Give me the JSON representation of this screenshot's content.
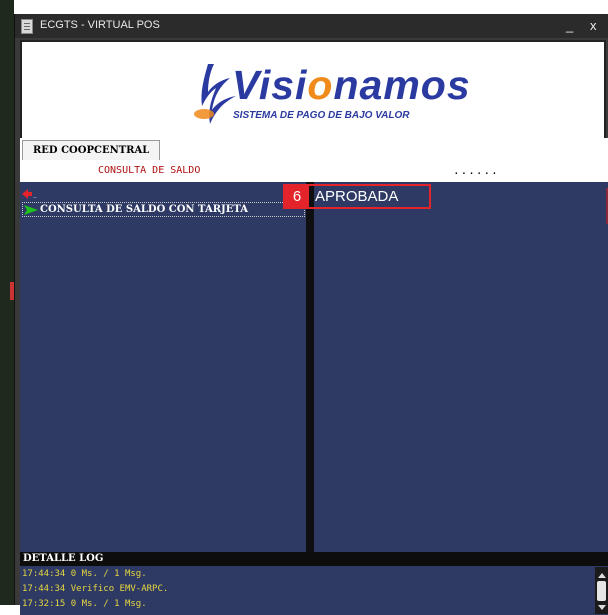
{
  "window": {
    "title": "ECGTS - VIRTUAL POS",
    "minimize_label": "_",
    "close_label": "x"
  },
  "logo": {
    "brand_prefix": "Visi",
    "brand_o": "o",
    "brand_suffix": "namos",
    "tagline": "SISTEMA DE PAGO DE BAJO VALOR"
  },
  "tabs": [
    {
      "label": "RED COOPCENTRAL"
    }
  ],
  "operation": {
    "title": "CONSULTA DE SALDO",
    "progress_dots": "......"
  },
  "menu": {
    "back_label": "..",
    "items": [
      {
        "label": "CONSULTA DE SALDO CON TARJETA"
      }
    ]
  },
  "result": {
    "marker_number": "6",
    "status_text": "APROBADA"
  },
  "log": {
    "header": "DETALLE LOG",
    "lines": [
      "17:44:34 0 Ms. / 1 Msg.",
      "17:44:34 Verifico EMV-ARPC.",
      "17:32:15 0 Ms. / 1 Msg."
    ]
  },
  "colors": {
    "panel_bg": "#2e3a64",
    "operation_text": "#b01010",
    "log_text": "#e6d640",
    "marker": "#e3242b",
    "brand_blue": "#2b3aa0",
    "brand_orange": "#f08a1a"
  }
}
